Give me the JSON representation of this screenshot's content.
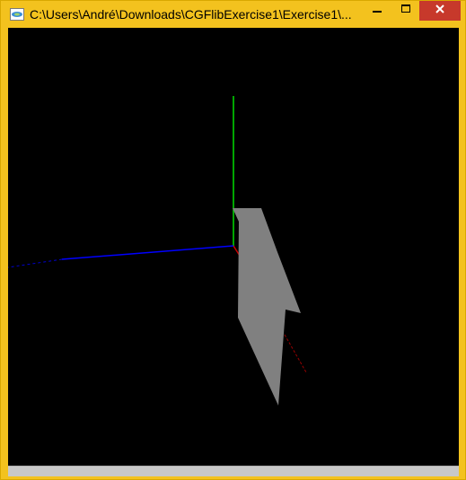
{
  "window": {
    "title": "C:\\Users\\André\\Downloads\\CGFlibExercise1\\Exercise1\\...",
    "frame_color": "#f3c21e",
    "close_color": "#c7392b",
    "controls": {
      "minimize_icon": "minimize-icon",
      "maximize_icon": "maximize-icon",
      "close_icon": "close-icon"
    }
  },
  "viewport": {
    "background": "#000000",
    "axes": {
      "x_color": "#cc0000",
      "y_color": "#00cc00",
      "z_color": "#0000ee"
    },
    "shape_color": "#808080"
  }
}
